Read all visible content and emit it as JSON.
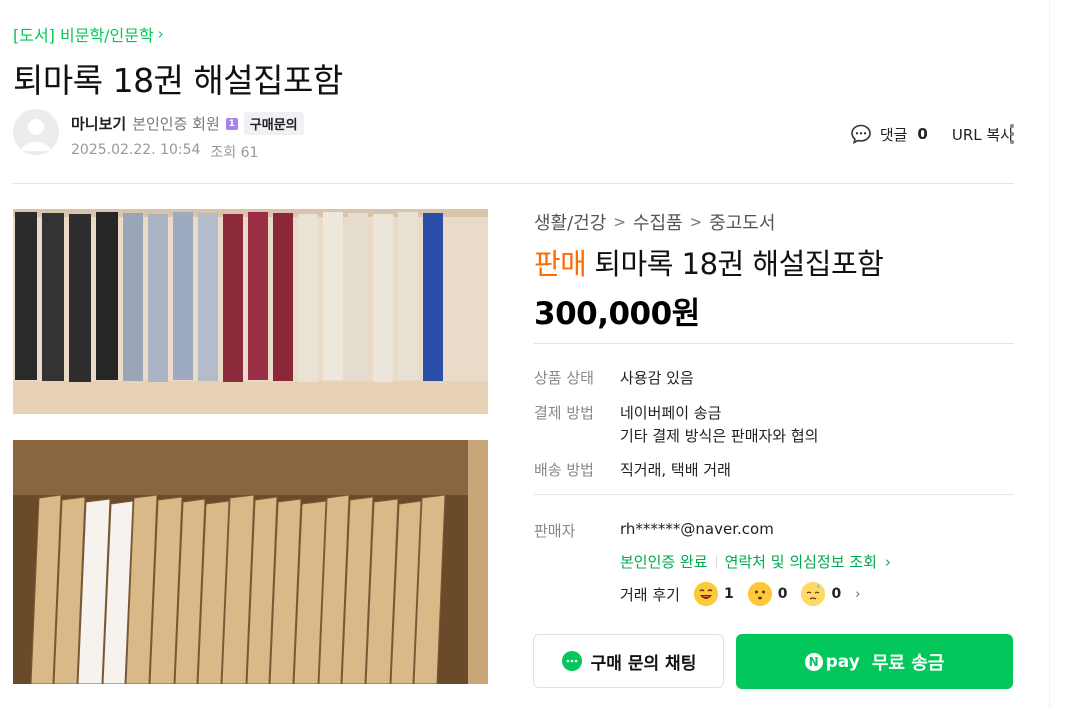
{
  "breadcrumb": {
    "text": "[도서] 비문학/인문학",
    "chevron": "›"
  },
  "post": {
    "title": "퇴마록 18권 해설집포함"
  },
  "author": {
    "nickname": "마니보기",
    "member_level": "본인인증 회원",
    "grade_badge": "1",
    "inquiry_tag": "구매문의",
    "date": "2025.02.22. 10:54",
    "views": "조회 61"
  },
  "header_actions": {
    "comment_label": "댓글",
    "comment_count": "0",
    "url_copy": "URL 복사"
  },
  "product": {
    "category": [
      "생활/건강",
      "수집품",
      "중고도서"
    ],
    "category_sep": ">",
    "status": "판매",
    "title": "퇴마록 18권 해설집포함",
    "price": "300,000원"
  },
  "details": {
    "condition_label": "상품 상태",
    "condition_value": "사용감 있음",
    "payment_label": "결제 방법",
    "payment_value_1": "네이버페이 송금",
    "payment_value_2": "기타 결제 방식은 판매자와 협의",
    "delivery_label": "배송 방법",
    "delivery_value": "직거래, 택배 거래"
  },
  "seller": {
    "label": "판매자",
    "id": "rh******@naver.com",
    "verified": "본인인증 완료",
    "contact_check": "연락처 및 의심정보 조회",
    "contact_chevron": "›",
    "review_label": "거래 후기",
    "reviews": [
      {
        "icon": "laughing-face-icon",
        "count": "1"
      },
      {
        "icon": "neutral-face-icon",
        "count": "0"
      },
      {
        "icon": "sweat-face-icon",
        "count": "0"
      }
    ],
    "review_chevron": "›"
  },
  "buttons": {
    "chat": "구매 문의 채팅",
    "pay_logo": "pay",
    "pay_n": "N",
    "pay": "무료 송금"
  },
  "colors": {
    "accent_green": "#03c75a",
    "sale_orange": "#ff6d00",
    "badge_purple": "#a782e8"
  }
}
